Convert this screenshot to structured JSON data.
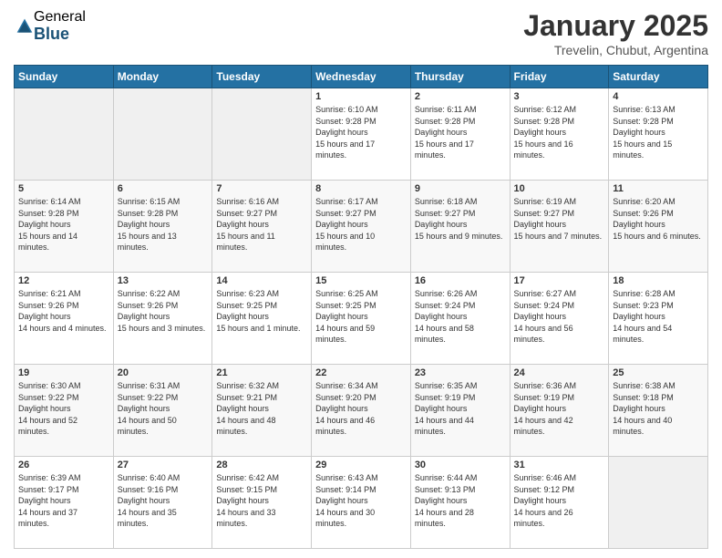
{
  "logo": {
    "general": "General",
    "blue": "Blue"
  },
  "header": {
    "title": "January 2025",
    "subtitle": "Trevelin, Chubut, Argentina"
  },
  "weekdays": [
    "Sunday",
    "Monday",
    "Tuesday",
    "Wednesday",
    "Thursday",
    "Friday",
    "Saturday"
  ],
  "weeks": [
    [
      {
        "day": "",
        "empty": true
      },
      {
        "day": "",
        "empty": true
      },
      {
        "day": "",
        "empty": true
      },
      {
        "day": "1",
        "sunrise": "6:10 AM",
        "sunset": "9:28 PM",
        "daylight": "15 hours and 17 minutes."
      },
      {
        "day": "2",
        "sunrise": "6:11 AM",
        "sunset": "9:28 PM",
        "daylight": "15 hours and 17 minutes."
      },
      {
        "day": "3",
        "sunrise": "6:12 AM",
        "sunset": "9:28 PM",
        "daylight": "15 hours and 16 minutes."
      },
      {
        "day": "4",
        "sunrise": "6:13 AM",
        "sunset": "9:28 PM",
        "daylight": "15 hours and 15 minutes."
      }
    ],
    [
      {
        "day": "5",
        "sunrise": "6:14 AM",
        "sunset": "9:28 PM",
        "daylight": "15 hours and 14 minutes."
      },
      {
        "day": "6",
        "sunrise": "6:15 AM",
        "sunset": "9:28 PM",
        "daylight": "15 hours and 13 minutes."
      },
      {
        "day": "7",
        "sunrise": "6:16 AM",
        "sunset": "9:27 PM",
        "daylight": "15 hours and 11 minutes."
      },
      {
        "day": "8",
        "sunrise": "6:17 AM",
        "sunset": "9:27 PM",
        "daylight": "15 hours and 10 minutes."
      },
      {
        "day": "9",
        "sunrise": "6:18 AM",
        "sunset": "9:27 PM",
        "daylight": "15 hours and 9 minutes."
      },
      {
        "day": "10",
        "sunrise": "6:19 AM",
        "sunset": "9:27 PM",
        "daylight": "15 hours and 7 minutes."
      },
      {
        "day": "11",
        "sunrise": "6:20 AM",
        "sunset": "9:26 PM",
        "daylight": "15 hours and 6 minutes."
      }
    ],
    [
      {
        "day": "12",
        "sunrise": "6:21 AM",
        "sunset": "9:26 PM",
        "daylight": "14 hours and 4 minutes."
      },
      {
        "day": "13",
        "sunrise": "6:22 AM",
        "sunset": "9:26 PM",
        "daylight": "15 hours and 3 minutes."
      },
      {
        "day": "14",
        "sunrise": "6:23 AM",
        "sunset": "9:25 PM",
        "daylight": "15 hours and 1 minute."
      },
      {
        "day": "15",
        "sunrise": "6:25 AM",
        "sunset": "9:25 PM",
        "daylight": "14 hours and 59 minutes."
      },
      {
        "day": "16",
        "sunrise": "6:26 AM",
        "sunset": "9:24 PM",
        "daylight": "14 hours and 58 minutes."
      },
      {
        "day": "17",
        "sunrise": "6:27 AM",
        "sunset": "9:24 PM",
        "daylight": "14 hours and 56 minutes."
      },
      {
        "day": "18",
        "sunrise": "6:28 AM",
        "sunset": "9:23 PM",
        "daylight": "14 hours and 54 minutes."
      }
    ],
    [
      {
        "day": "19",
        "sunrise": "6:30 AM",
        "sunset": "9:22 PM",
        "daylight": "14 hours and 52 minutes."
      },
      {
        "day": "20",
        "sunrise": "6:31 AM",
        "sunset": "9:22 PM",
        "daylight": "14 hours and 50 minutes."
      },
      {
        "day": "21",
        "sunrise": "6:32 AM",
        "sunset": "9:21 PM",
        "daylight": "14 hours and 48 minutes."
      },
      {
        "day": "22",
        "sunrise": "6:34 AM",
        "sunset": "9:20 PM",
        "daylight": "14 hours and 46 minutes."
      },
      {
        "day": "23",
        "sunrise": "6:35 AM",
        "sunset": "9:19 PM",
        "daylight": "14 hours and 44 minutes."
      },
      {
        "day": "24",
        "sunrise": "6:36 AM",
        "sunset": "9:19 PM",
        "daylight": "14 hours and 42 minutes."
      },
      {
        "day": "25",
        "sunrise": "6:38 AM",
        "sunset": "9:18 PM",
        "daylight": "14 hours and 40 minutes."
      }
    ],
    [
      {
        "day": "26",
        "sunrise": "6:39 AM",
        "sunset": "9:17 PM",
        "daylight": "14 hours and 37 minutes."
      },
      {
        "day": "27",
        "sunrise": "6:40 AM",
        "sunset": "9:16 PM",
        "daylight": "14 hours and 35 minutes."
      },
      {
        "day": "28",
        "sunrise": "6:42 AM",
        "sunset": "9:15 PM",
        "daylight": "14 hours and 33 minutes."
      },
      {
        "day": "29",
        "sunrise": "6:43 AM",
        "sunset": "9:14 PM",
        "daylight": "14 hours and 30 minutes."
      },
      {
        "day": "30",
        "sunrise": "6:44 AM",
        "sunset": "9:13 PM",
        "daylight": "14 hours and 28 minutes."
      },
      {
        "day": "31",
        "sunrise": "6:46 AM",
        "sunset": "9:12 PM",
        "daylight": "14 hours and 26 minutes."
      },
      {
        "day": "",
        "empty": true
      }
    ]
  ]
}
